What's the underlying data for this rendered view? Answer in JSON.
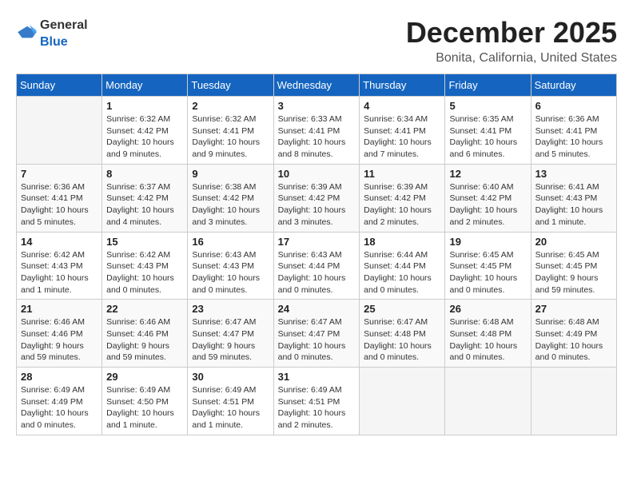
{
  "header": {
    "logo": {
      "general": "General",
      "blue": "Blue"
    },
    "title": "December 2025",
    "location": "Bonita, California, United States"
  },
  "days_of_week": [
    "Sunday",
    "Monday",
    "Tuesday",
    "Wednesday",
    "Thursday",
    "Friday",
    "Saturday"
  ],
  "weeks": [
    [
      {
        "day": "",
        "sunrise": "",
        "sunset": "",
        "daylight": ""
      },
      {
        "day": "1",
        "sunrise": "Sunrise: 6:32 AM",
        "sunset": "Sunset: 4:42 PM",
        "daylight": "Daylight: 10 hours and 9 minutes."
      },
      {
        "day": "2",
        "sunrise": "Sunrise: 6:32 AM",
        "sunset": "Sunset: 4:41 PM",
        "daylight": "Daylight: 10 hours and 9 minutes."
      },
      {
        "day": "3",
        "sunrise": "Sunrise: 6:33 AM",
        "sunset": "Sunset: 4:41 PM",
        "daylight": "Daylight: 10 hours and 8 minutes."
      },
      {
        "day": "4",
        "sunrise": "Sunrise: 6:34 AM",
        "sunset": "Sunset: 4:41 PM",
        "daylight": "Daylight: 10 hours and 7 minutes."
      },
      {
        "day": "5",
        "sunrise": "Sunrise: 6:35 AM",
        "sunset": "Sunset: 4:41 PM",
        "daylight": "Daylight: 10 hours and 6 minutes."
      },
      {
        "day": "6",
        "sunrise": "Sunrise: 6:36 AM",
        "sunset": "Sunset: 4:41 PM",
        "daylight": "Daylight: 10 hours and 5 minutes."
      }
    ],
    [
      {
        "day": "7",
        "sunrise": "Sunrise: 6:36 AM",
        "sunset": "Sunset: 4:41 PM",
        "daylight": "Daylight: 10 hours and 5 minutes."
      },
      {
        "day": "8",
        "sunrise": "Sunrise: 6:37 AM",
        "sunset": "Sunset: 4:42 PM",
        "daylight": "Daylight: 10 hours and 4 minutes."
      },
      {
        "day": "9",
        "sunrise": "Sunrise: 6:38 AM",
        "sunset": "Sunset: 4:42 PM",
        "daylight": "Daylight: 10 hours and 3 minutes."
      },
      {
        "day": "10",
        "sunrise": "Sunrise: 6:39 AM",
        "sunset": "Sunset: 4:42 PM",
        "daylight": "Daylight: 10 hours and 3 minutes."
      },
      {
        "day": "11",
        "sunrise": "Sunrise: 6:39 AM",
        "sunset": "Sunset: 4:42 PM",
        "daylight": "Daylight: 10 hours and 2 minutes."
      },
      {
        "day": "12",
        "sunrise": "Sunrise: 6:40 AM",
        "sunset": "Sunset: 4:42 PM",
        "daylight": "Daylight: 10 hours and 2 minutes."
      },
      {
        "day": "13",
        "sunrise": "Sunrise: 6:41 AM",
        "sunset": "Sunset: 4:43 PM",
        "daylight": "Daylight: 10 hours and 1 minute."
      }
    ],
    [
      {
        "day": "14",
        "sunrise": "Sunrise: 6:42 AM",
        "sunset": "Sunset: 4:43 PM",
        "daylight": "Daylight: 10 hours and 1 minute."
      },
      {
        "day": "15",
        "sunrise": "Sunrise: 6:42 AM",
        "sunset": "Sunset: 4:43 PM",
        "daylight": "Daylight: 10 hours and 0 minutes."
      },
      {
        "day": "16",
        "sunrise": "Sunrise: 6:43 AM",
        "sunset": "Sunset: 4:43 PM",
        "daylight": "Daylight: 10 hours and 0 minutes."
      },
      {
        "day": "17",
        "sunrise": "Sunrise: 6:43 AM",
        "sunset": "Sunset: 4:44 PM",
        "daylight": "Daylight: 10 hours and 0 minutes."
      },
      {
        "day": "18",
        "sunrise": "Sunrise: 6:44 AM",
        "sunset": "Sunset: 4:44 PM",
        "daylight": "Daylight: 10 hours and 0 minutes."
      },
      {
        "day": "19",
        "sunrise": "Sunrise: 6:45 AM",
        "sunset": "Sunset: 4:45 PM",
        "daylight": "Daylight: 10 hours and 0 minutes."
      },
      {
        "day": "20",
        "sunrise": "Sunrise: 6:45 AM",
        "sunset": "Sunset: 4:45 PM",
        "daylight": "Daylight: 9 hours and 59 minutes."
      }
    ],
    [
      {
        "day": "21",
        "sunrise": "Sunrise: 6:46 AM",
        "sunset": "Sunset: 4:46 PM",
        "daylight": "Daylight: 9 hours and 59 minutes."
      },
      {
        "day": "22",
        "sunrise": "Sunrise: 6:46 AM",
        "sunset": "Sunset: 4:46 PM",
        "daylight": "Daylight: 9 hours and 59 minutes."
      },
      {
        "day": "23",
        "sunrise": "Sunrise: 6:47 AM",
        "sunset": "Sunset: 4:47 PM",
        "daylight": "Daylight: 9 hours and 59 minutes."
      },
      {
        "day": "24",
        "sunrise": "Sunrise: 6:47 AM",
        "sunset": "Sunset: 4:47 PM",
        "daylight": "Daylight: 10 hours and 0 minutes."
      },
      {
        "day": "25",
        "sunrise": "Sunrise: 6:47 AM",
        "sunset": "Sunset: 4:48 PM",
        "daylight": "Daylight: 10 hours and 0 minutes."
      },
      {
        "day": "26",
        "sunrise": "Sunrise: 6:48 AM",
        "sunset": "Sunset: 4:48 PM",
        "daylight": "Daylight: 10 hours and 0 minutes."
      },
      {
        "day": "27",
        "sunrise": "Sunrise: 6:48 AM",
        "sunset": "Sunset: 4:49 PM",
        "daylight": "Daylight: 10 hours and 0 minutes."
      }
    ],
    [
      {
        "day": "28",
        "sunrise": "Sunrise: 6:49 AM",
        "sunset": "Sunset: 4:49 PM",
        "daylight": "Daylight: 10 hours and 0 minutes."
      },
      {
        "day": "29",
        "sunrise": "Sunrise: 6:49 AM",
        "sunset": "Sunset: 4:50 PM",
        "daylight": "Daylight: 10 hours and 1 minute."
      },
      {
        "day": "30",
        "sunrise": "Sunrise: 6:49 AM",
        "sunset": "Sunset: 4:51 PM",
        "daylight": "Daylight: 10 hours and 1 minute."
      },
      {
        "day": "31",
        "sunrise": "Sunrise: 6:49 AM",
        "sunset": "Sunset: 4:51 PM",
        "daylight": "Daylight: 10 hours and 2 minutes."
      },
      {
        "day": "",
        "sunrise": "",
        "sunset": "",
        "daylight": ""
      },
      {
        "day": "",
        "sunrise": "",
        "sunset": "",
        "daylight": ""
      },
      {
        "day": "",
        "sunrise": "",
        "sunset": "",
        "daylight": ""
      }
    ]
  ]
}
